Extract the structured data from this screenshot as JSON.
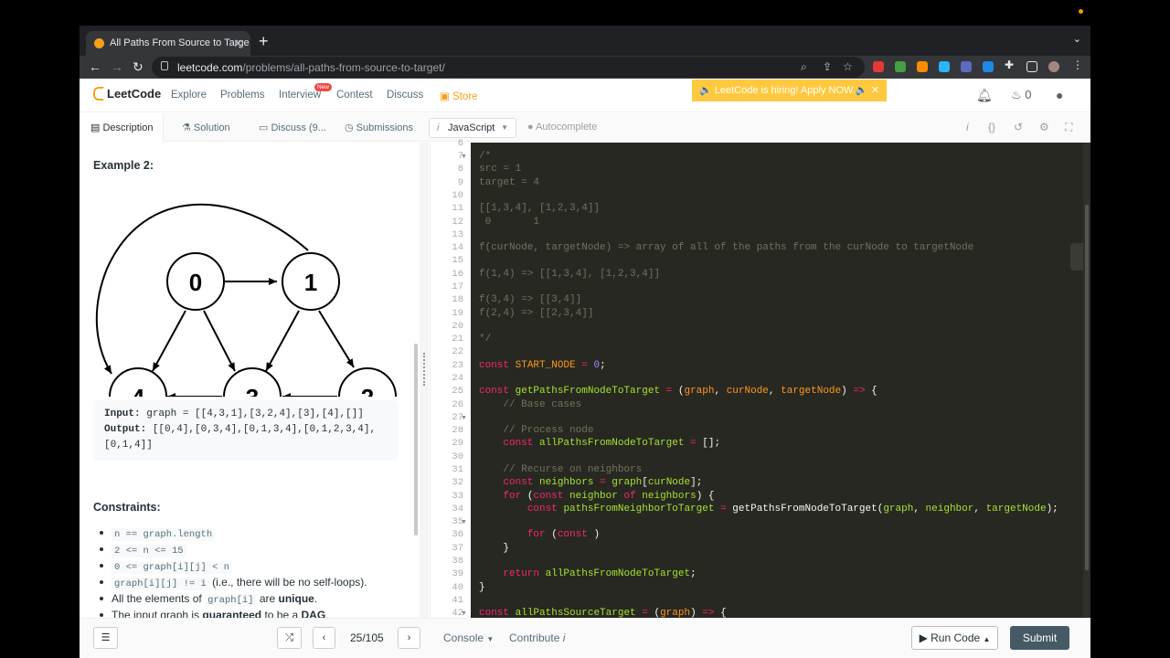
{
  "browser": {
    "tab_title": "All Paths From Source to Targe",
    "close_glyph": "✕",
    "new_tab_glyph": "+",
    "url_domain": "leetcode.com",
    "url_path": "/problems/all-paths-from-source-to-target/"
  },
  "navbar": {
    "logo": "LeetCode",
    "links": [
      "Explore",
      "Problems",
      "Interview",
      "Contest",
      "Discuss"
    ],
    "new_badge": "New",
    "store": "Store",
    "banner": "🔈 LeetCode is hiring! Apply NOW.🔈",
    "coins": "0"
  },
  "subbar": {
    "tabs": [
      "Description",
      "Solution",
      "Discuss (9...",
      "Submissions"
    ],
    "language": "JavaScript",
    "autocomplete": "Autocomplete"
  },
  "description": {
    "example_title": "Example 2:",
    "graph_nodes": [
      "0",
      "1",
      "2",
      "3",
      "4"
    ],
    "input_label": "Input:",
    "input_value": "graph = [[4,3,1],[3,2,4],[3],[4],[]]",
    "output_label": "Output:",
    "output_value": "[[0,4],[0,3,4],[0,1,3,4],[0,1,2,3,4],",
    "output_value_2": "[0,1,4]]",
    "constraints_title": "Constraints:",
    "constraints": {
      "c1": "n == graph.length",
      "c2": "2 <= n <= 15",
      "c3": "0 <= graph[i][j] < n",
      "c4_code": "graph[i][j] != i",
      "c4_text": "(i.e., there will be no self-loops).",
      "c5_pre": "All the elements of",
      "c5_code": "graph[i]",
      "c5_mid": "are",
      "c5_bold": "unique",
      "c5_end": ".",
      "c6_pre": "The input graph is",
      "c6_bold": "guaranteed",
      "c6_mid": "to be a",
      "c6_bold2": "DAG",
      "c6_end": "."
    }
  },
  "editor": {
    "line_numbers": [
      "6",
      "7",
      "8",
      "9",
      "10",
      "11",
      "12",
      "13",
      "14",
      "15",
      "16",
      "17",
      "18",
      "19",
      "20",
      "21",
      "22",
      "23",
      "24",
      "25",
      "26",
      "27",
      "28",
      "29",
      "30",
      "31",
      "32",
      "33",
      "34",
      "35",
      "36",
      "37",
      "38",
      "39",
      "40",
      "41",
      "42"
    ],
    "lines": {
      "l7": "/*",
      "l8": "src = 1",
      "l9": "target = 4",
      "l11": "[[1,3,4], [1,2,3,4]]",
      "l12": " 0       1",
      "l14": "f(curNode, targetNode) => array of all of the paths from the curNode to targetNode",
      "l16": "f(1,4) => [[1,3,4], [1,2,3,4]]",
      "l18": "f(3,4) => [[3,4]]",
      "l19": "f(2,4) => [[2,3,4]]",
      "l21": "*/",
      "l27": "    // Base cases",
      "l29": "    // Process node",
      "l31": "    // Recurse on neighbors"
    }
  },
  "footer": {
    "page": "25/105",
    "console": "Console",
    "contribute": "Contribute",
    "run": "Run Code",
    "submit": "Submit"
  }
}
